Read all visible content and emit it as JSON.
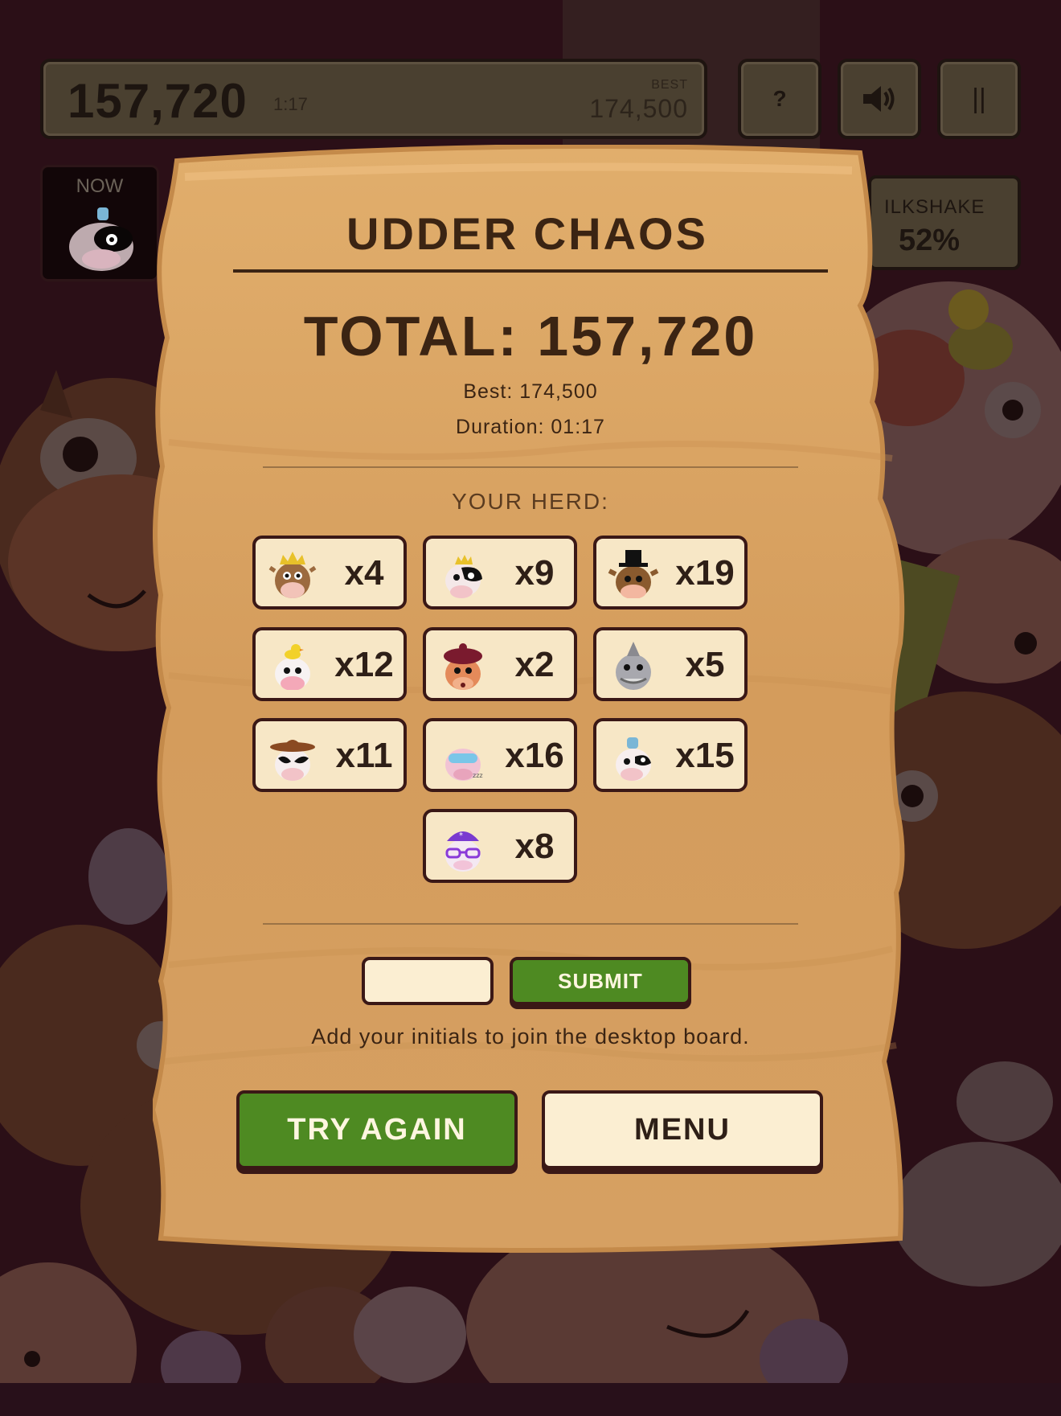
{
  "hud": {
    "score": "157,720",
    "timer": "1:17",
    "best_label": "BEST",
    "best_value": "174,500",
    "help_label": "?",
    "pause_label": "||",
    "now_label": "NOW",
    "milkshake_label": "ILKSHAKE",
    "milkshake_value": "52%"
  },
  "modal": {
    "title": "UDDER CHAOS",
    "total": "TOTAL: 157,720",
    "best": "Best: 174,500",
    "duration": "Duration: 01:17",
    "herd_label": "YOUR HERD:",
    "herd": [
      {
        "cow": "king-cow-icon",
        "count": "x4"
      },
      {
        "cow": "queen-cow-icon",
        "count": "x9"
      },
      {
        "cow": "tophat-cow-icon",
        "count": "x19"
      },
      {
        "cow": "duck-cow-icon",
        "count": "x12"
      },
      {
        "cow": "beret-cow-icon",
        "count": "x2"
      },
      {
        "cow": "shark-cow-icon",
        "count": "x5"
      },
      {
        "cow": "cowboy-cow-icon",
        "count": "x11"
      },
      {
        "cow": "sleepy-cow-icon",
        "count": "x16"
      },
      {
        "cow": "chef-cow-icon",
        "count": "x15"
      },
      {
        "cow": "granny-cow-icon",
        "count": "x8"
      }
    ],
    "initials_placeholder": "",
    "submit_label": "SUBMIT",
    "hint": "Add your initials to join the desktop board.",
    "try_again_label": "TRY AGAIN",
    "menu_label": "MENU"
  },
  "colors": {
    "paper": "#d9a566",
    "ink": "#3b2413",
    "green": "#4e8a22",
    "cream": "#f7e7c6"
  }
}
